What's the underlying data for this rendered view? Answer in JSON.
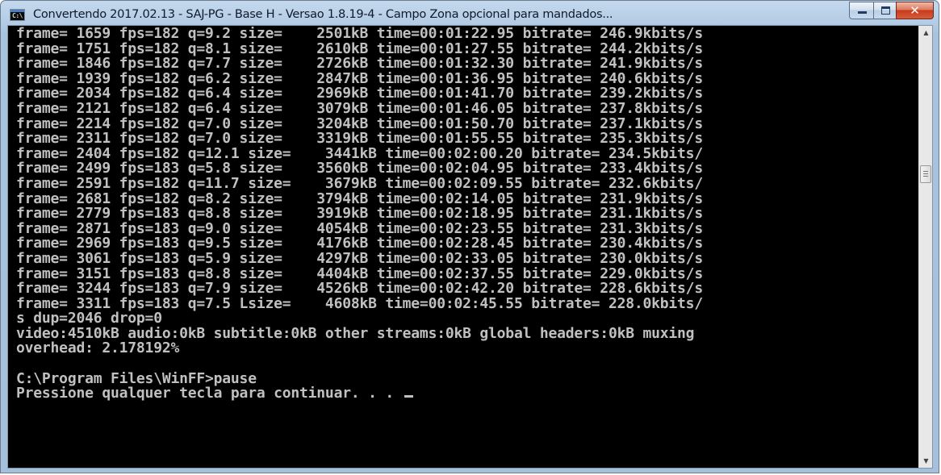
{
  "window": {
    "title": "Convertendo 2017.02.13 - SAJ-PG - Base H - Versao 1.8.19-4 - Campo Zona opcional para mandados...",
    "icon": "console-app-icon",
    "icon_glyph": "C:\\",
    "buttons": {
      "minimize_icon": "minimize-icon",
      "maximize_icon": "maximize-icon",
      "close_icon": "close-icon",
      "close_glyph": "✕"
    }
  },
  "colors": {
    "console_background": "#000000",
    "console_text": "#c0c0c0",
    "close_button": "#c73b1d"
  },
  "console": {
    "lines": [
      "frame= 1659 fps=182 q=9.2 size=    2501kB time=00:01:22.95 bitrate= 246.9kbits/s",
      "frame= 1751 fps=182 q=8.1 size=    2610kB time=00:01:27.55 bitrate= 244.2kbits/s",
      "frame= 1846 fps=182 q=7.7 size=    2726kB time=00:01:32.30 bitrate= 241.9kbits/s",
      "frame= 1939 fps=182 q=6.2 size=    2847kB time=00:01:36.95 bitrate= 240.6kbits/s",
      "frame= 2034 fps=182 q=6.4 size=    2969kB time=00:01:41.70 bitrate= 239.2kbits/s",
      "frame= 2121 fps=182 q=6.4 size=    3079kB time=00:01:46.05 bitrate= 237.8kbits/s",
      "frame= 2214 fps=182 q=7.0 size=    3204kB time=00:01:50.70 bitrate= 237.1kbits/s",
      "frame= 2311 fps=182 q=7.0 size=    3319kB time=00:01:55.55 bitrate= 235.3kbits/s",
      "frame= 2404 fps=182 q=12.1 size=    3441kB time=00:02:00.20 bitrate= 234.5kbits/",
      "frame= 2499 fps=183 q=5.8 size=    3560kB time=00:02:04.95 bitrate= 233.4kbits/s",
      "frame= 2591 fps=182 q=11.7 size=    3679kB time=00:02:09.55 bitrate= 232.6kbits/",
      "frame= 2681 fps=182 q=8.2 size=    3794kB time=00:02:14.05 bitrate= 231.9kbits/s",
      "frame= 2779 fps=183 q=8.8 size=    3919kB time=00:02:18.95 bitrate= 231.1kbits/s",
      "frame= 2871 fps=183 q=9.0 size=    4054kB time=00:02:23.55 bitrate= 231.3kbits/s",
      "frame= 2969 fps=183 q=9.5 size=    4176kB time=00:02:28.45 bitrate= 230.4kbits/s",
      "frame= 3061 fps=183 q=5.9 size=    4297kB time=00:02:33.05 bitrate= 230.0kbits/s",
      "frame= 3151 fps=183 q=8.8 size=    4404kB time=00:02:37.55 bitrate= 229.0kbits/s",
      "frame= 3244 fps=183 q=7.9 size=    4526kB time=00:02:42.20 bitrate= 228.6kbits/s",
      "frame= 3311 fps=183 q=7.5 Lsize=    4608kB time=00:02:45.55 bitrate= 228.0kbits/",
      "s dup=2046 drop=0",
      "video:4510kB audio:0kB subtitle:0kB other streams:0kB global headers:0kB muxing",
      "overhead: 2.178192%",
      "",
      "C:\\Program Files\\WinFF>pause",
      "Pressione qualquer tecla para continuar. . . "
    ],
    "cursor_visible": true
  },
  "scrollbar": {
    "up_arrow": "▲",
    "down_arrow": "▼",
    "up_icon": "scroll-up-arrow-icon",
    "down_icon": "scroll-down-arrow-icon",
    "thumb_icon": "scroll-thumb-grip-icon"
  }
}
